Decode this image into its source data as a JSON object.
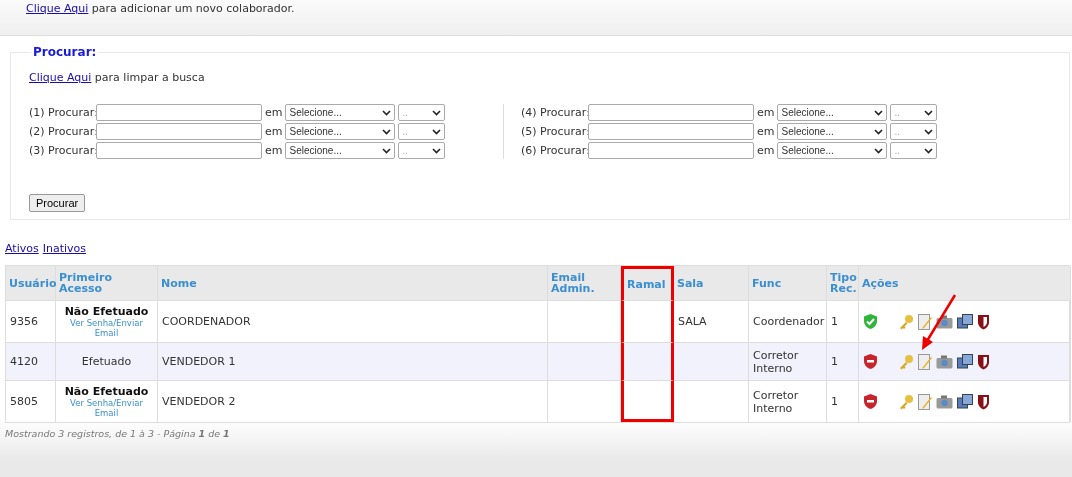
{
  "add_notice": {
    "link": "Clique Aqui",
    "text": "para adicionar um novo colaborador."
  },
  "search": {
    "legend": "Procurar:",
    "clear_link": "Clique Aqui",
    "clear_text": "para limpar a busca",
    "fields": [
      {
        "label": "(1) Procurar:",
        "joiner": "em",
        "field": "Selecione...",
        "operator": ".."
      },
      {
        "label": "(2) Procurar:",
        "joiner": "em",
        "field": "Selecione...",
        "operator": ".."
      },
      {
        "label": "(3) Procurar:",
        "joiner": "em",
        "field": "Selecione...",
        "operator": ".."
      },
      {
        "label": "(4) Procurar:",
        "joiner": "em",
        "field": "Selecione...",
        "operator": ".."
      },
      {
        "label": "(5) Procurar:",
        "joiner": "em",
        "field": "Selecione...",
        "operator": ".."
      },
      {
        "label": "(6) Procurar:",
        "joiner": "em",
        "field": "Selecione...",
        "operator": ".."
      }
    ],
    "button": "Procurar"
  },
  "filters": [
    {
      "label": "Ativos"
    },
    {
      "label": "Inativos"
    }
  ],
  "table": {
    "columns": [
      {
        "label": "Usuário",
        "highlighted": false
      },
      {
        "label": "Primeiro Acesso",
        "highlighted": false
      },
      {
        "label": "Nome",
        "highlighted": false
      },
      {
        "label": "Email Admin.",
        "highlighted": false
      },
      {
        "label": "Ramal",
        "highlighted": true
      },
      {
        "label": "Sala",
        "highlighted": false
      },
      {
        "label": "Func",
        "highlighted": false
      },
      {
        "label": "Tipo Rec.",
        "highlighted": false
      },
      {
        "label": "Ações",
        "highlighted": false
      }
    ],
    "rows": [
      {
        "user": "9356",
        "first_access": {
          "kind": "pending",
          "text": "Não Efetuado",
          "link": "Ver Senha/Enviar Email"
        },
        "name": "COORDENADOR",
        "sala": "SALA",
        "func": "Coordenador",
        "tipo": "1",
        "enabled": true,
        "arrow": false
      },
      {
        "user": "4120",
        "first_access": {
          "kind": "done",
          "text": "Efetuado"
        },
        "name": "VENDEDOR 1",
        "func": "Corretor Interno",
        "tipo": "1",
        "enabled": false,
        "arrow": true
      },
      {
        "user": "5805",
        "first_access": {
          "kind": "pending",
          "text": "Não Efetuado",
          "link": "Ver Senha/Enviar Email"
        },
        "name": "VENDEDOR 2",
        "func": "Corretor Interno",
        "tipo": "1",
        "enabled": false,
        "arrow": false
      }
    ]
  },
  "pagination": "Mostrando 3 registros, de 1 à 3 - Página **1** de **1**"
}
